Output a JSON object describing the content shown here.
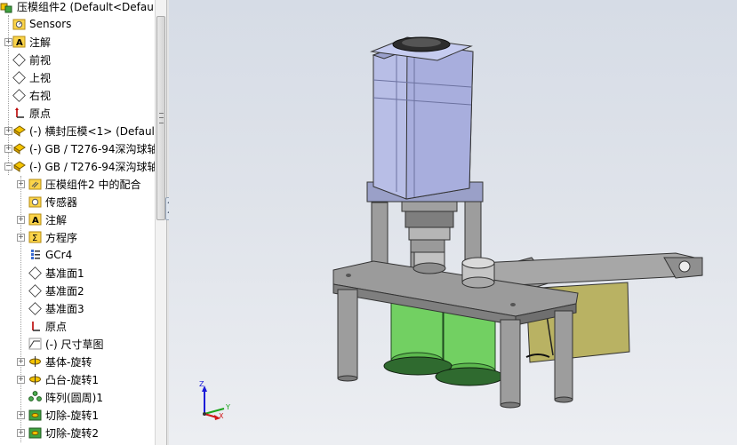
{
  "tree": {
    "root_label": "压模组件2 (Default<Default",
    "items": [
      {
        "label": "Sensors"
      },
      {
        "label": "注解"
      },
      {
        "label": "前视"
      },
      {
        "label": "上视"
      },
      {
        "label": "右视"
      },
      {
        "label": "原点"
      },
      {
        "label": "(-) 横封压模<1> (Default"
      },
      {
        "label": "(-) GB / T276-94深沟球轴"
      },
      {
        "label": "(-) GB / T276-94深沟球轴"
      },
      {
        "label": "压模组件2 中的配合"
      },
      {
        "label": "传感器"
      },
      {
        "label": "注解"
      },
      {
        "label": "方程序"
      },
      {
        "label": "GCr4"
      },
      {
        "label": "基准面1"
      },
      {
        "label": "基准面2"
      },
      {
        "label": "基准面3"
      },
      {
        "label": "原点"
      },
      {
        "label": "(-) 尺寸草图"
      },
      {
        "label": "基体-旋转"
      },
      {
        "label": "凸台-旋转1"
      },
      {
        "label": "阵列(圆周)1"
      },
      {
        "label": "切除-旋转1"
      },
      {
        "label": "切除-旋转2"
      }
    ]
  },
  "triad": {
    "x": "X",
    "y": "Y",
    "z": "Z"
  },
  "colors": {
    "motor": "#b8bee6",
    "plate": "#8c8c8c",
    "roller": "#6fd260",
    "gear": "#2f6a2f",
    "bracket": "#b8b060"
  }
}
